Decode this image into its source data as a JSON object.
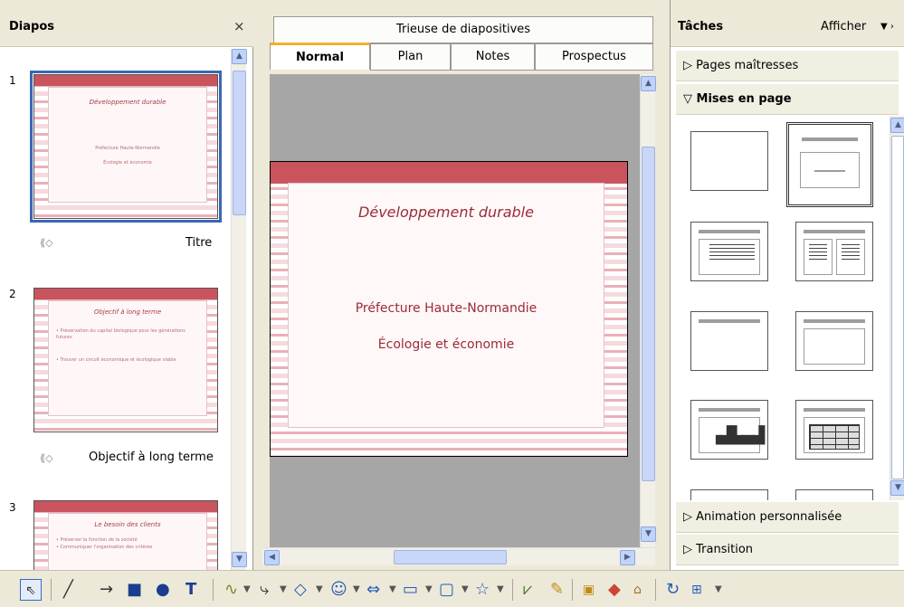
{
  "slides_pane": {
    "title": "Diapos",
    "close": "×",
    "slides": [
      {
        "number": "1",
        "label": "Titre",
        "title": "Développement durable",
        "sub1": "Préfecture Haute-Normandie",
        "sub2": "Écologie et économie"
      },
      {
        "number": "2",
        "label": "Objectif à long terme",
        "title": "Objectif à long terme",
        "bullet1": "• Préservation du capital biologique pour les générations futures",
        "bullet2": "• Trouver un circuit économique et écologique viable"
      },
      {
        "number": "3",
        "label": "",
        "title": "Le besoin des clients",
        "bullet1": "• Préserver la fonction de la société",
        "bullet2": "• Communiquer l'organisation des critères"
      }
    ]
  },
  "view_tabs": {
    "sorter": "Trieuse de diapositives",
    "tabs": [
      "Normal",
      "Plan",
      "Notes",
      "Prospectus"
    ],
    "active": "Normal"
  },
  "slide": {
    "title": "Développement durable",
    "line1": "Préfecture Haute-Normandie",
    "line2": "Écologie et économie"
  },
  "tasks_pane": {
    "title": "Tâches",
    "view_menu": "Afficher",
    "sections": {
      "master_pages": "Pages maîtresses",
      "layouts": "Mises en page",
      "custom_animation": "Animation personnalisée",
      "transition": "Transition"
    }
  },
  "toolbar": {
    "icons": [
      "select-arrow-icon",
      "line-icon",
      "arrow-line-icon",
      "rectangle-icon",
      "ellipse-icon",
      "text-icon",
      "curve-icon",
      "connector-icon",
      "basic-shapes-icon",
      "symbol-shapes-icon",
      "block-arrows-icon",
      "flowchart-icon",
      "callouts-icon",
      "stars-icon",
      "points-icon",
      "glue-points-icon",
      "fontwork-icon",
      "from-file-icon",
      "gallery-icon",
      "rotate-icon",
      "alignment-icon"
    ]
  }
}
